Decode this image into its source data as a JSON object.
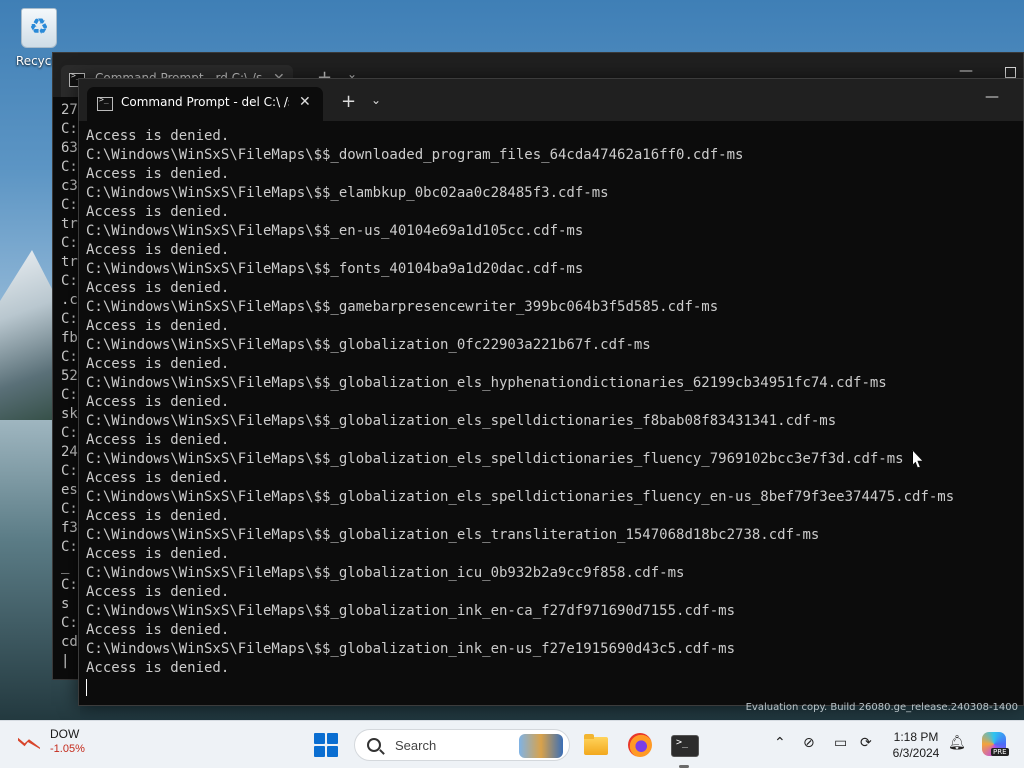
{
  "desktop": {
    "icons": [
      {
        "label": "Recycle"
      }
    ],
    "watermark": "Evaluation copy. Build 26080.ge_release.240308-1400"
  },
  "back_window": {
    "tab_title": "Command Prompt - rd  C:\\ /s",
    "visible_fragments": [
      "27",
      "C:",
      "63",
      "C:",
      "c3",
      "C:",
      "tr",
      "C:",
      "tr",
      "C:",
      ".c",
      "C:",
      "fb",
      "C:",
      "52",
      "C:",
      "sk",
      "C:",
      "24",
      "C:",
      "es",
      "C:",
      "f3",
      "C:",
      " _",
      "C:",
      "s",
      "C:",
      "cd",
      "|"
    ]
  },
  "front_window": {
    "tab_title": "Command Prompt - del  C:\\ /s",
    "new_tab_label": "+",
    "dropdown_label": "⌄",
    "close_label": "✕",
    "minimize_label": "—",
    "console_lines": [
      "Access is denied.",
      "C:\\Windows\\WinSxS\\FileMaps\\$$_downloaded_program_files_64cda47462a16ff0.cdf-ms",
      "Access is denied.",
      "C:\\Windows\\WinSxS\\FileMaps\\$$_elambkup_0bc02aa0c28485f3.cdf-ms",
      "Access is denied.",
      "C:\\Windows\\WinSxS\\FileMaps\\$$_en-us_40104e69a1d105cc.cdf-ms",
      "Access is denied.",
      "C:\\Windows\\WinSxS\\FileMaps\\$$_fonts_40104ba9a1d20dac.cdf-ms",
      "Access is denied.",
      "C:\\Windows\\WinSxS\\FileMaps\\$$_gamebarpresencewriter_399bc064b3f5d585.cdf-ms",
      "Access is denied.",
      "C:\\Windows\\WinSxS\\FileMaps\\$$_globalization_0fc22903a221b67f.cdf-ms",
      "Access is denied.",
      "C:\\Windows\\WinSxS\\FileMaps\\$$_globalization_els_hyphenationdictionaries_62199cb34951fc74.cdf-ms",
      "Access is denied.",
      "C:\\Windows\\WinSxS\\FileMaps\\$$_globalization_els_spelldictionaries_f8bab08f83431341.cdf-ms",
      "Access is denied.",
      "C:\\Windows\\WinSxS\\FileMaps\\$$_globalization_els_spelldictionaries_fluency_7969102bcc3e7f3d.cdf-ms",
      "Access is denied.",
      "C:\\Windows\\WinSxS\\FileMaps\\$$_globalization_els_spelldictionaries_fluency_en-us_8bef79f3ee374475.cdf-ms",
      "Access is denied.",
      "C:\\Windows\\WinSxS\\FileMaps\\$$_globalization_els_transliteration_1547068d18bc2738.cdf-ms",
      "Access is denied.",
      "C:\\Windows\\WinSxS\\FileMaps\\$$_globalization_icu_0b932b2a9cc9f858.cdf-ms",
      "Access is denied.",
      "C:\\Windows\\WinSxS\\FileMaps\\$$_globalization_ink_en-ca_f27df971690d7155.cdf-ms",
      "Access is denied.",
      "C:\\Windows\\WinSxS\\FileMaps\\$$_globalization_ink_en-us_f27e1915690d43c5.cdf-ms",
      "Access is denied."
    ]
  },
  "taskbar": {
    "stock": {
      "name": "DOW",
      "change": "-1.05%"
    },
    "search_placeholder": "Search",
    "clock": {
      "time": "1:18 PM",
      "date": "6/3/2024"
    },
    "copilot_badge": "PRE"
  },
  "colors": {
    "console_bg": "#0c0c0c",
    "console_text": "#cccccc",
    "titlebar_bg": "#202020",
    "taskbar_bg": "#eef2f6",
    "stock_negative": "#c42b1c",
    "start_blue": "#0a6ed1"
  },
  "icons": {
    "recycle_bin": "recycle-bin-icon",
    "cmd": "cmd-icon",
    "start": "windows-start-icon",
    "search": "search-icon",
    "file_explorer": "folder-icon",
    "firefox": "firefox-icon",
    "terminal": "terminal-icon",
    "tray": [
      "chevron-up-icon",
      "network-icon",
      "display-icon",
      "sync-icon",
      "bell-icon",
      "copilot-icon"
    ]
  }
}
